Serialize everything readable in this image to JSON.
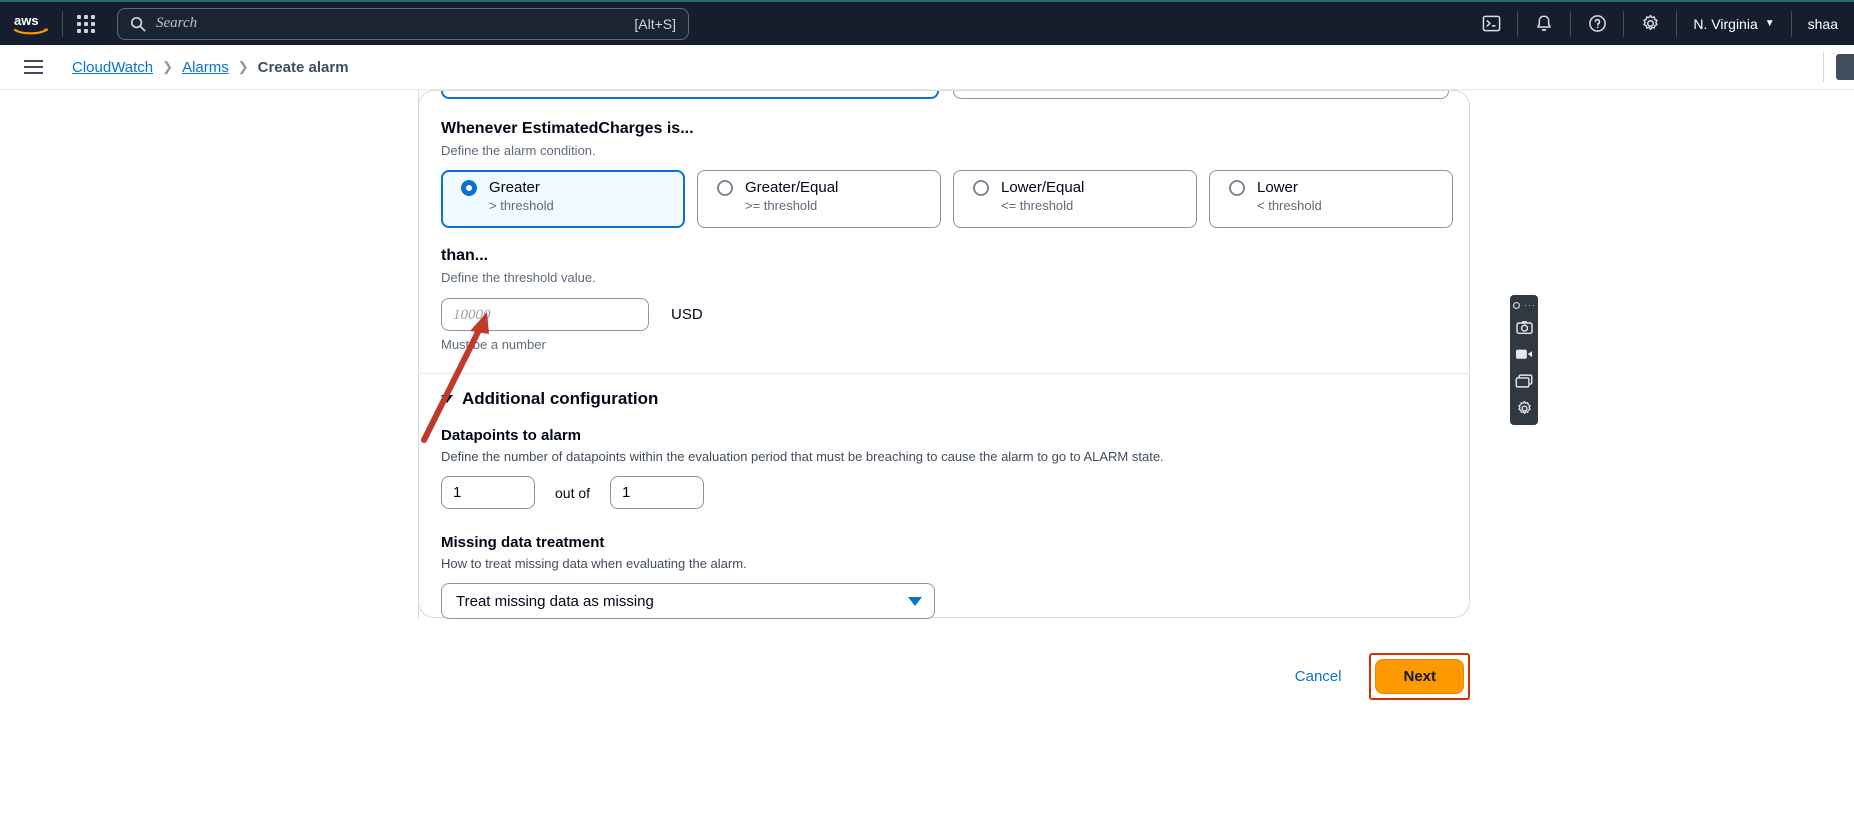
{
  "topnav": {
    "logo_alt": "aws",
    "apps_icon": "apps-grid-icon",
    "search": {
      "placeholder": "Search",
      "hint": "[Alt+S]"
    },
    "icons": {
      "cloudshell": "cloudshell-icon",
      "notifications": "bell-icon",
      "help": "question-circle-icon",
      "settings": "gear-icon"
    },
    "region": "N. Virginia",
    "region_caret": "▼",
    "account": "shaa"
  },
  "breadcrumb": {
    "menu_icon": "hamburger-icon",
    "items": [
      {
        "label": "CloudWatch",
        "link": true
      },
      {
        "label": "Alarms",
        "link": true
      },
      {
        "label": "Create alarm",
        "link": false
      }
    ],
    "separator": "❯"
  },
  "condition": {
    "title": "Whenever EstimatedCharges is...",
    "description": "Define the alarm condition.",
    "options": [
      {
        "label": "Greater",
        "sub": "> threshold",
        "selected": true
      },
      {
        "label": "Greater/Equal",
        "sub": ">= threshold",
        "selected": false
      },
      {
        "label": "Lower/Equal",
        "sub": "<= threshold",
        "selected": false
      },
      {
        "label": "Lower",
        "sub": "< threshold",
        "selected": false
      }
    ]
  },
  "threshold": {
    "title": "than...",
    "description": "Define the threshold value.",
    "value": "",
    "placeholder": "10000",
    "unit": "USD",
    "hint": "Must be a number"
  },
  "additional": {
    "title": "Additional configuration",
    "expanded": true,
    "chevron_icon": "chevron-down-icon",
    "datapoints": {
      "title": "Datapoints to alarm",
      "description": "Define the number of datapoints within the evaluation period that must be breaching to cause the alarm to go to ALARM state.",
      "value": "1",
      "out_of_label": "out of",
      "total": "1"
    },
    "missing_data": {
      "title": "Missing data treatment",
      "description": "How to treat missing data when evaluating the alarm.",
      "selected": "Treat missing data as missing",
      "caret_icon": "chevron-down-icon"
    }
  },
  "footer": {
    "cancel_label": "Cancel",
    "next_label": "Next",
    "next_highlight_color": "#cf3500",
    "next_bg_color": "#ff9900"
  },
  "annotation": {
    "arrow_color": "#c0392b",
    "arrow_target": "threshold-input"
  },
  "recorder_toolbar": {
    "buttons": [
      "pin-icon",
      "camera-icon",
      "video-camera-icon",
      "window-icon",
      "gear-icon"
    ]
  }
}
